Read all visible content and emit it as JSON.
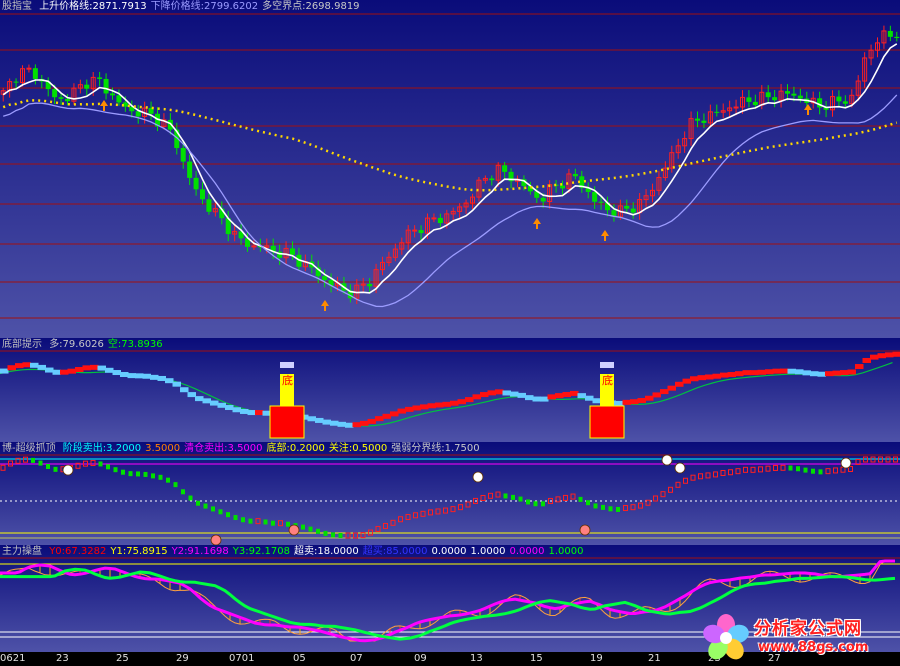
{
  "panel1": {
    "name": "股指宝",
    "items": [
      {
        "label": "上升价格线:",
        "value": "2871.7913",
        "color": "#ffffff"
      },
      {
        "label": "下降价格线:",
        "value": "2799.6202",
        "color": "#9c9cff"
      },
      {
        "label": "多空界点:",
        "value": "2698.9819",
        "color": "#c8c8c8"
      }
    ]
  },
  "panel2": {
    "name": "底部提示",
    "items": [
      {
        "label": "多:",
        "value": "79.6026",
        "color": "#c8c8c8"
      },
      {
        "label": "空:",
        "value": "73.8936",
        "color": "#00ff00"
      }
    ],
    "marker_char": "底"
  },
  "panel3": {
    "name": "博-超级抓顶",
    "items": [
      {
        "label": "阶段卖出:",
        "value": "3.2000",
        "color": "#00ffff"
      },
      {
        "label": "",
        "value": "3.5000",
        "color": "#ff8000"
      },
      {
        "label": "清仓卖出:",
        "value": "3.5000",
        "color": "#ff00ff"
      },
      {
        "label": "底部:",
        "value": "0.2000",
        "color": "#ffff00"
      },
      {
        "label": "关注:",
        "value": "0.5000",
        "color": "#ffff00"
      },
      {
        "label": "强弱分界线:",
        "value": "1.7500",
        "color": "#c8c8c8"
      }
    ]
  },
  "panel4": {
    "name": "主力操盘",
    "items": [
      {
        "label": "Y0:",
        "value": "67.3282",
        "color": "#ff0000"
      },
      {
        "label": "Y1:",
        "value": "75.8915",
        "color": "#ffff00"
      },
      {
        "label": "Y2:",
        "value": "91.1698",
        "color": "#ff00ff"
      },
      {
        "label": "Y3:",
        "value": "92.1708",
        "color": "#00ff00"
      },
      {
        "label": "超卖:",
        "value": "18.0000",
        "color": "#ffffff"
      },
      {
        "label": "超买:",
        "value": "85.0000",
        "color": "#3333ff"
      },
      {
        "label": "",
        "value": "0.0000",
        "color": "#ffffff"
      },
      {
        "label": "",
        "value": "1.0000",
        "color": "#ffffff"
      },
      {
        "label": "",
        "value": "0.0000",
        "color": "#ff00ff"
      },
      {
        "label": "",
        "value": "1.0000",
        "color": "#00ff00"
      }
    ]
  },
  "x_ticks": [
    "0621",
    "23",
    "25",
    "29",
    "0701",
    "05",
    "07",
    "09",
    "13",
    "15",
    "19",
    "21",
    "23",
    "27"
  ],
  "logo": {
    "line1": "分析家公式网",
    "line2": "www.88gs.com"
  },
  "chart_data": [
    {
      "type": "candlestick",
      "title": "股指宝",
      "series": [
        {
          "name": "上升价格线",
          "color": "#ffffff",
          "last": 2871.7913
        },
        {
          "name": "下降价格线",
          "color": "#9c9cff",
          "last": 2799.6202
        },
        {
          "name": "多空界点",
          "color": "#ffd700",
          "last": 2698.9819
        }
      ],
      "close_profile": [
        0.78,
        0.84,
        0.86,
        0.85,
        0.8,
        0.76,
        0.77,
        0.8,
        0.83,
        0.82,
        0.78,
        0.74,
        0.72,
        0.72,
        0.7,
        0.68,
        0.62,
        0.52,
        0.44,
        0.4,
        0.36,
        0.32,
        0.28,
        0.26,
        0.26,
        0.24,
        0.24,
        0.22,
        0.2,
        0.17,
        0.14,
        0.12,
        0.1,
        0.11,
        0.14,
        0.19,
        0.23,
        0.28,
        0.31,
        0.33,
        0.35,
        0.36,
        0.38,
        0.41,
        0.46,
        0.5,
        0.52,
        0.5,
        0.48,
        0.44,
        0.42,
        0.46,
        0.48,
        0.5,
        0.46,
        0.41,
        0.39,
        0.37,
        0.39,
        0.4,
        0.44,
        0.5,
        0.56,
        0.63,
        0.68,
        0.7,
        0.71,
        0.73,
        0.74,
        0.76,
        0.76,
        0.77,
        0.78,
        0.78,
        0.77,
        0.75,
        0.74,
        0.75,
        0.76,
        0.77,
        0.9,
        0.96,
        0.98,
        0.99
      ]
    },
    {
      "type": "line",
      "title": "底部提示",
      "series": [
        {
          "name": "多",
          "last": 79.6026
        },
        {
          "name": "空",
          "last": 73.8936
        }
      ],
      "bottom_signals": [
        21,
        57
      ]
    },
    {
      "type": "line",
      "title": "博-超级抓顶",
      "series": [
        {
          "name": "阶段卖出",
          "value": 3.2
        },
        {
          "name": "清仓卖出",
          "value": 3.5
        },
        {
          "name": "底部",
          "value": 0.2
        },
        {
          "name": "关注",
          "value": 0.5
        },
        {
          "name": "强弱分界线",
          "value": 1.75
        }
      ]
    },
    {
      "type": "line",
      "title": "主力操盘",
      "series": [
        {
          "name": "Y0",
          "last": 67.3282
        },
        {
          "name": "Y1",
          "last": 75.8915
        },
        {
          "name": "Y2",
          "last": 91.1698
        },
        {
          "name": "Y3",
          "last": 92.1708
        }
      ],
      "levels": {
        "超卖": 18,
        "超买": 85
      }
    }
  ]
}
